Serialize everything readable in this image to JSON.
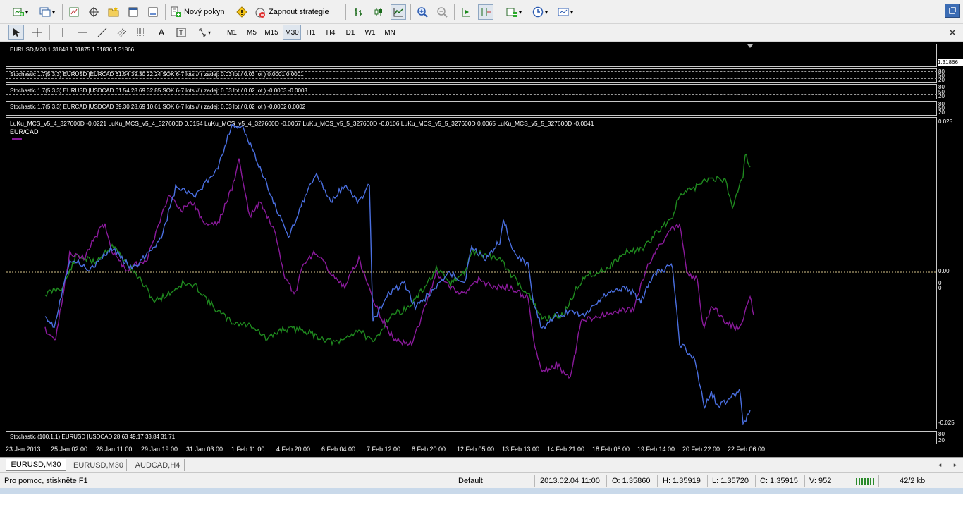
{
  "toolbar": {
    "new_order_label": "Nový pokyn",
    "strategy_label": "Zapnout strategie"
  },
  "timeframes": [
    "M1",
    "M5",
    "M15",
    "M30",
    "H1",
    "H4",
    "D1",
    "W1",
    "MN"
  ],
  "active_timeframe": "M30",
  "main_chart": {
    "header": "EURUSD,M30  1.31848 1.31875 1.31836 1.31866",
    "price_label": "1.31866"
  },
  "stoch_panels": [
    {
      "header": "Stochastic 1.7(5,3,3) EURUSD |EURCAD 61.54 39.30 22.24  SOK 6-7 lots  //  ( zadej: 0.03 lot / 0.03 lot ) 0.0001 0.0001",
      "scale_top": "80",
      "scale_mid": "50",
      "scale_bot": "20"
    },
    {
      "header": "Stochastic 1.7(5,3,3) EURUSD |USDCAD 61.54 28.69 32.85  SOK 6-7 lots  //  ( zadej: 0.03 lot / 0.02 lot ) -0.0003 -0.0003",
      "scale_top": "80",
      "scale_mid": "50",
      "scale_bot": "20"
    },
    {
      "header": "Stochastic 1.7(5,3,3) EURCAD |USDCAD 39.30 28.69 10.61  SOK 6-7 lots  //  ( zadej: 0.03 lot / 0.02 lot ) -0.0002 0.0002",
      "scale_top": "80",
      "scale_mid": "50",
      "scale_bot": "20"
    }
  ],
  "indicator_panel": {
    "header": "LuKu_MCS_v5_4_327600D -0.0221  LuKu_MCS_v5_4_327600D 0.0154  LuKu_MCS_v5_4_327600D -0.0067  LuKu_MCS_v5_5_327600D -0.0106  LuKu_MCS_v5_5_327600D 0.0065  LuKu_MCS_v5_5_327600D -0.0041",
    "legend_label": "EUR/CAD",
    "scale_top": "0.025",
    "scale_zero": "0.00",
    "scale_bottom": "-0.025",
    "scale_zero_alt": "0",
    "scale_zero_alt2": "0"
  },
  "bottom_stoch": {
    "header": "Stochastic (100,1,1) EURUSD |USDCAD 28.63 49.17 33.84 31.71",
    "scale_top": "80",
    "scale_bot": "20"
  },
  "x_labels": [
    "23 Jan 2013",
    "25 Jan 02:00",
    "28 Jan 11:00",
    "29 Jan 19:00",
    "31 Jan 03:00",
    "1 Feb 11:00",
    "4 Feb 20:00",
    "6 Feb 04:00",
    "7 Feb 12:00",
    "8 Feb 20:00",
    "12 Feb 05:00",
    "13 Feb 13:00",
    "14 Feb 21:00",
    "18 Feb 06:00",
    "19 Feb 14:00",
    "20 Feb 22:00",
    "22 Feb 06:00"
  ],
  "tabs": [
    "EURUSD,M30",
    "EURUSD,M30",
    "AUDCAD,H4"
  ],
  "active_tab": 0,
  "status": {
    "help": "Pro pomoc, stiskněte F1",
    "profile": "Default",
    "datetime": "2013.02.04 11:00",
    "open": "O: 1.35860",
    "high": "H: 1.35919",
    "low": "L: 1.35720",
    "close": "C: 1.35915",
    "volume": "V: 952",
    "traffic": "42/2 kb"
  },
  "colors": {
    "series_blue": "#4a6fe0",
    "series_purple": "#8b1a9c",
    "series_green": "#1f8a1f",
    "background": "#000000"
  }
}
